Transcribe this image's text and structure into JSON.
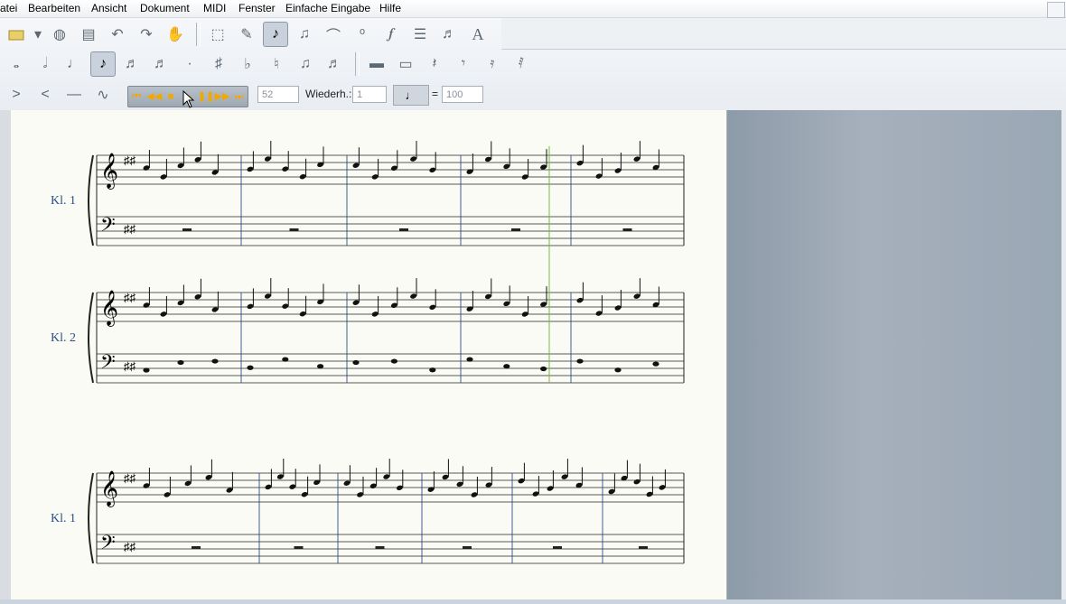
{
  "menu": {
    "items": [
      "atei",
      "Bearbeiten",
      "Ansicht",
      "Dokument",
      "MIDI",
      "Fenster",
      "Einfache Eingabe",
      "Hilfe"
    ]
  },
  "toolbar": {
    "row1_icons": [
      "folder-icon",
      "dropdown-icon",
      "disk-icon",
      "print-icon",
      "undo-icon",
      "redo-icon",
      "hand-icon",
      "select-icon",
      "edit-icon",
      "note-icon",
      "notes-icon",
      "slur-icon",
      "ornament-icon",
      "dynamics-icon",
      "text-block-icon",
      "lyrics-icon",
      "text-icon"
    ],
    "row2_icons": [
      "whole-note-icon",
      "half-note-icon",
      "quarter-note-icon",
      "eighth-note-icon",
      "sixteenth-note-icon",
      "thirtysecond-note-icon",
      "dot-icon",
      "sharp-icon",
      "flat-icon",
      "natural-icon",
      "tie-icon",
      "triplet-icon",
      "whole-rest-icon",
      "half-rest-icon",
      "quarter-rest-icon",
      "eighth-rest-icon",
      "sixteenth-rest-icon",
      "thirtysecond-rest-icon"
    ],
    "row3_icons": [
      "decrescendo-icon",
      "crescendo-icon",
      "line-icon",
      "curve-icon"
    ],
    "active_note": "eighth-note-icon"
  },
  "playback": {
    "measure_value": "52",
    "repeat_label": "Wiederh.:",
    "repeat_value": "1",
    "equals": "=",
    "tempo_value": "100"
  },
  "score": {
    "systems": [
      {
        "label": "Kl. 1"
      },
      {
        "label": "Kl. 2"
      },
      {
        "label": "Kl. 1"
      }
    ],
    "colors": {
      "label": "#2e4f86",
      "barline": "#2e4f86",
      "playhead": "#7dbb3a"
    }
  }
}
